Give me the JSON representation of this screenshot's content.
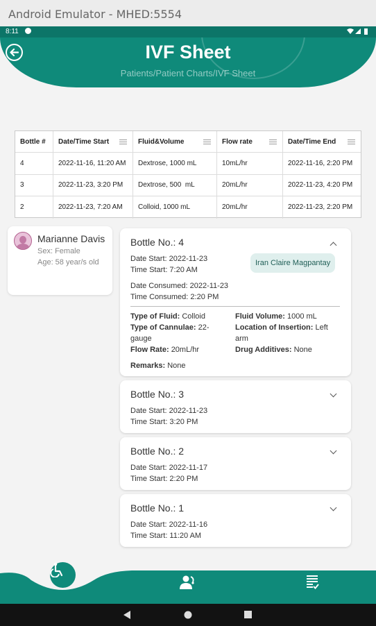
{
  "window": {
    "title": "Android Emulator - MHED:5554"
  },
  "status_bar": {
    "time": "8:11"
  },
  "header": {
    "title": "IVF Sheet",
    "breadcrumb": "Patients/Patient Charts/IVF Sheet"
  },
  "table": {
    "columns": [
      "Bottle #",
      "Date/Time Start",
      "Fluid&Volume",
      "Flow rate",
      "Date/Time End"
    ],
    "rows": [
      [
        "4",
        "2022-11-16, 11:20 AM",
        "Dextrose, 1000 mL",
        "10mL/hr",
        "2022-11-16, 2:20 PM"
      ],
      [
        "3",
        "2022-11-23, 3:20 PM",
        "Dextrose, 500  mL",
        "20mL/hr",
        "2022-11-23, 4:20 PM"
      ],
      [
        "2",
        "2022-11-23, 7:20 AM",
        "Colloid, 1000 mL",
        "20mL/hr",
        "2022-11-23, 2:20 PM"
      ]
    ]
  },
  "patient": {
    "name": "Marianne Davis",
    "sex": "Sex: Female",
    "age": "Age: 58 year/s old"
  },
  "cards": [
    {
      "title": "Bottle No.: 4",
      "date_start": "Date Start: 2022-11-23",
      "time_start": "Time Start: 7:20 AM",
      "date_consumed": "Date Consumed: 2022-11-23",
      "time_consumed": "Time Consumed: 2:20 PM",
      "nurse": "Iran Claire Magpantay",
      "details": {
        "type_fluid_label": "Type of Fluid:",
        "type_fluid": "Colloid",
        "fluid_volume_label": "Fluid Volume:",
        "fluid_volume": "1000 mL",
        "cannulae_label": "Type of Cannulae:",
        "cannulae": "22-gauge",
        "location_label": "Location of Insertion:",
        "location": "Left arm",
        "flow_rate_label": "Flow Rate:",
        "flow_rate": "20mL/hr",
        "additives_label": "Drug Additives:",
        "additives": "None",
        "remarks_label": "Remarks:",
        "remarks": "None"
      }
    },
    {
      "title": "Bottle No.: 3",
      "date_start": "Date Start: 2022-11-23",
      "time_start": "Time Start: 3:20 PM"
    },
    {
      "title": "Bottle No.: 2",
      "date_start": "Date Start: 2022-11-17",
      "time_start": "Time Start: 2:20 PM"
    },
    {
      "title": "Bottle No.: 1",
      "date_start": "Date Start: 2022-11-16",
      "time_start": "Time Start: 11:20 AM"
    }
  ],
  "colors": {
    "primary": "#0f8a7a",
    "chip_bg": "#dfefed"
  },
  "icons": [
    "back-arrow-icon",
    "wheelchair-icon",
    "doctor-icon",
    "checklist-icon",
    "back-triangle-icon",
    "home-circle-icon",
    "recents-square-icon"
  ]
}
